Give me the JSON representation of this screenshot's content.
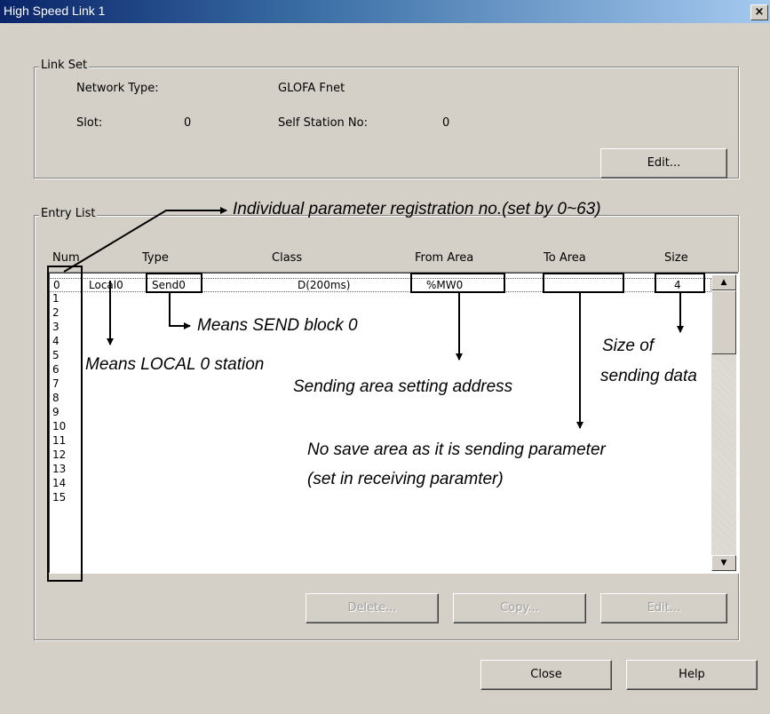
{
  "window": {
    "title": "High Speed Link 1",
    "close_glyph": "×"
  },
  "link_set": {
    "legend": "Link Set",
    "network_type_label": "Network Type:",
    "network_type_value": "GLOFA Fnet",
    "slot_label": "Slot:",
    "slot_value": "0",
    "self_station_label": "Self Station No:",
    "self_station_value": "0",
    "edit_label": "Edit..."
  },
  "entry_list": {
    "legend": "Entry List",
    "columns": [
      "Num",
      "Type",
      "Class",
      "From Area",
      "To Area",
      "Size"
    ],
    "row0": {
      "num": "0",
      "station": "Local0",
      "type": "Send0",
      "class": "D(200ms)",
      "from": "%MW0",
      "to": "",
      "size": "4"
    },
    "nums": [
      "0",
      "1",
      "2",
      "3",
      "4",
      "5",
      "6",
      "7",
      "8",
      "9",
      "10",
      "11",
      "12",
      "13",
      "14",
      "15"
    ],
    "delete_label": "Delete...",
    "copy_label": "Copy...",
    "edit_label": "Edit..."
  },
  "footer": {
    "close_label": "Close",
    "help_label": "Help"
  },
  "annotations": {
    "registration": "Individual parameter registration no.(set by 0~63)",
    "send_block": "Means SEND block 0",
    "local_station": "Means LOCAL 0 station",
    "sending_area": "Sending area setting address",
    "size_line1": "Size of",
    "size_line2": "sending data",
    "no_save_line1": "No save area as it is sending parameter",
    "no_save_line2": "(set in receiving paramter)"
  },
  "icons": {
    "scroll_up": "triangle-up",
    "scroll_down": "triangle-down"
  }
}
